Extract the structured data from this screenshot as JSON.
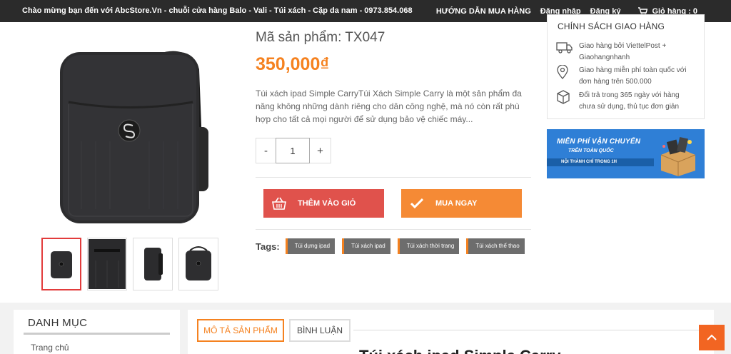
{
  "topbar": {
    "welcome": "Chào mừng bạn đến với AbcStore.Vn - chuỗi cửa hàng Balo - Vali - Túi xách - Cặp da nam - 0973.854.068",
    "guide": "HƯỚNG DẪN MUA HÀNG",
    "login": "Đăng nhập",
    "register": "Đăng ký",
    "cart": "Giỏ hàng : 0"
  },
  "product": {
    "sku": "Mã sản phẩm: TX047",
    "price": "350,000₫",
    "description": "Túi xách ipad Simple CarryTúi Xách Simple Carry là một sản phẩm đa năng không những dành riêng cho dân công nghệ, mà nó còn rất phù hợp cho tất cả mọi người để sử dụng bảo vệ chiếc máy...",
    "quantity": "1",
    "minus": "-",
    "plus": "+",
    "add_to_cart": "THÊM VÀO GIỎ",
    "buy_now": "MUA NGAY",
    "tags_label": "Tags:",
    "tags": [
      "Túi dựng ipad",
      "Túi xách ipad",
      "Túi xách thời trang",
      "Túi xách thể thao"
    ]
  },
  "shipping": {
    "title": "CHÍNH SÁCH GIAO HÀNG",
    "items": [
      {
        "icon": "truck-icon",
        "text": "Giao hàng bởi ViettelPost + Giaohangnhanh"
      },
      {
        "icon": "location-pin-icon",
        "text": "Giao hàng miễn phí toàn quốc với đơn hàng trên 500.000"
      },
      {
        "icon": "box-icon",
        "text": "Đổi trả trong 365 ngày với hàng chưa sử dụng, thủ tục đơn giản"
      }
    ]
  },
  "banner": {
    "line1": "MIỄN PHÍ VẬN CHUYỂN",
    "line2": "TRÊN TOÀN QUỐC",
    "line3": "NỘI THÀNH CHỈ TRONG 1H"
  },
  "sidebar": {
    "title": "DANH MỤC",
    "items": [
      "Trang chủ"
    ]
  },
  "tabs": {
    "description": "MÔ TẢ SẢN PHẨM",
    "comments": "BÌNH LUẬN",
    "content_heading": "Túi xách ipad Simple Carry"
  },
  "colors": {
    "accent": "#f58220",
    "add_button": "#e0524c",
    "buy_button": "#f58a35",
    "topbar": "#2b2b2b",
    "back_to_top": "#f26522"
  }
}
